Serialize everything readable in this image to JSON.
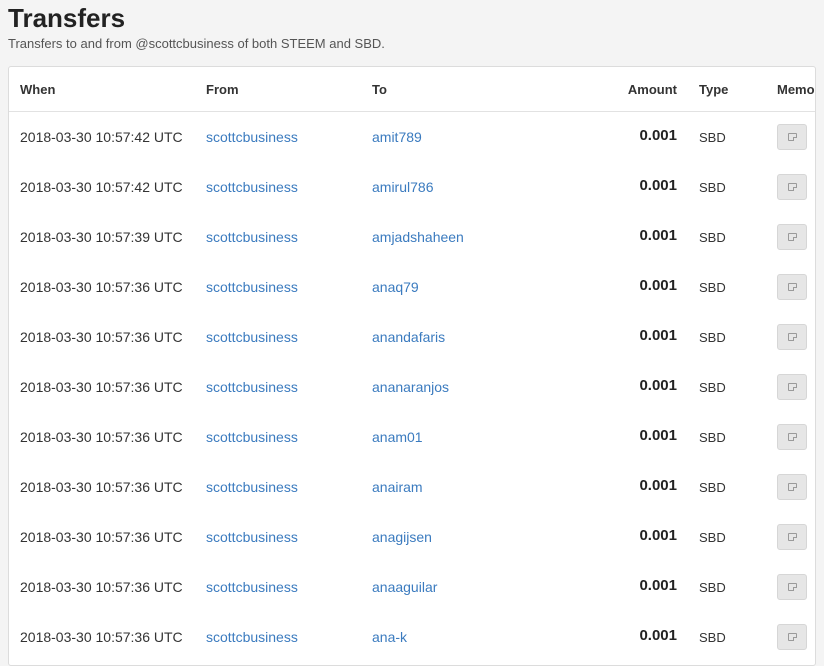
{
  "header": {
    "title": "Transfers",
    "subtitle": "Transfers to and from @scottcbusiness of both STEEM and SBD."
  },
  "table": {
    "columns": {
      "when": "When",
      "from": "From",
      "to": "To",
      "amount": "Amount",
      "type": "Type",
      "memo": "Memo"
    },
    "rows": [
      {
        "when": "2018-03-30 10:57:42 UTC",
        "from": "scottcbusiness",
        "to": "amit789",
        "amount": "0.001",
        "type": "SBD"
      },
      {
        "when": "2018-03-30 10:57:42 UTC",
        "from": "scottcbusiness",
        "to": "amirul786",
        "amount": "0.001",
        "type": "SBD"
      },
      {
        "when": "2018-03-30 10:57:39 UTC",
        "from": "scottcbusiness",
        "to": "amjadshaheen",
        "amount": "0.001",
        "type": "SBD"
      },
      {
        "when": "2018-03-30 10:57:36 UTC",
        "from": "scottcbusiness",
        "to": "anaq79",
        "amount": "0.001",
        "type": "SBD"
      },
      {
        "when": "2018-03-30 10:57:36 UTC",
        "from": "scottcbusiness",
        "to": "anandafaris",
        "amount": "0.001",
        "type": "SBD"
      },
      {
        "when": "2018-03-30 10:57:36 UTC",
        "from": "scottcbusiness",
        "to": "ananaranjos",
        "amount": "0.001",
        "type": "SBD"
      },
      {
        "when": "2018-03-30 10:57:36 UTC",
        "from": "scottcbusiness",
        "to": "anam01",
        "amount": "0.001",
        "type": "SBD"
      },
      {
        "when": "2018-03-30 10:57:36 UTC",
        "from": "scottcbusiness",
        "to": "anairam",
        "amount": "0.001",
        "type": "SBD"
      },
      {
        "when": "2018-03-30 10:57:36 UTC",
        "from": "scottcbusiness",
        "to": "anagijsen",
        "amount": "0.001",
        "type": "SBD"
      },
      {
        "when": "2018-03-30 10:57:36 UTC",
        "from": "scottcbusiness",
        "to": "anaaguilar",
        "amount": "0.001",
        "type": "SBD"
      },
      {
        "when": "2018-03-30 10:57:36 UTC",
        "from": "scottcbusiness",
        "to": "ana-k",
        "amount": "0.001",
        "type": "SBD"
      }
    ]
  },
  "icons": {
    "memo": "memo-icon"
  }
}
